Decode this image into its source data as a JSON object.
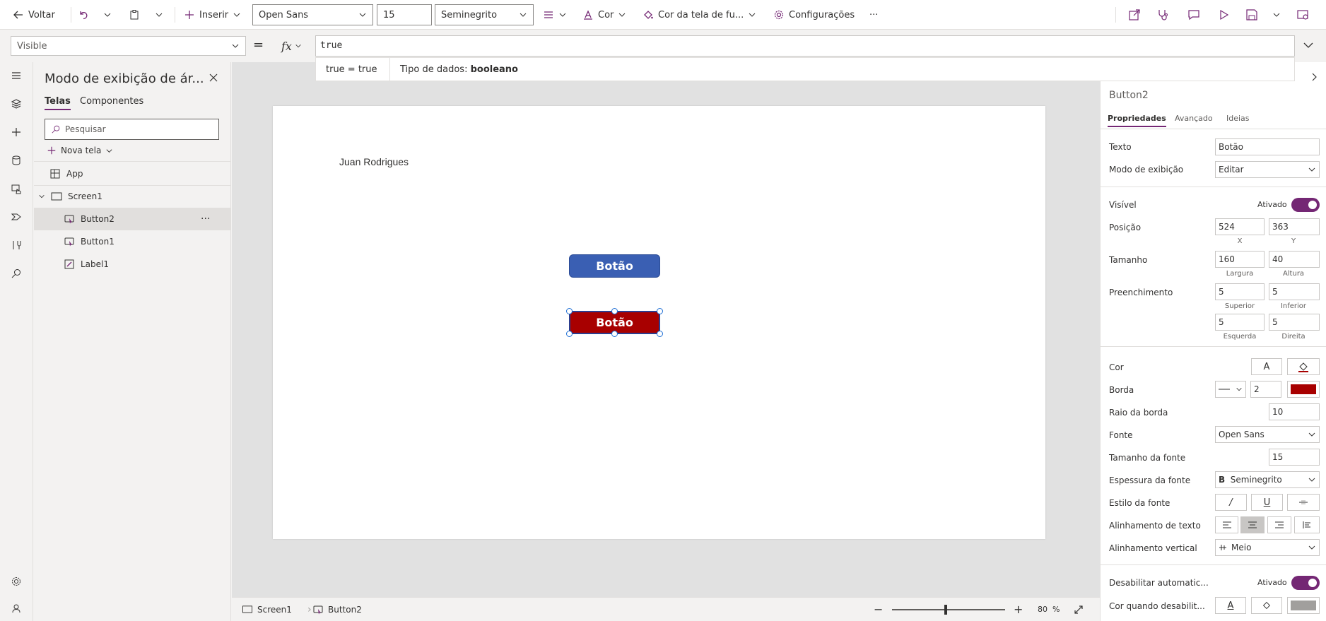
{
  "toolbar": {
    "back_label": "Voltar",
    "insert_label": "Inserir",
    "font_value": "Open Sans",
    "font_size_value": "15",
    "font_weight_value": "Seminegrito",
    "color_label": "Cor",
    "fill_label": "Cor da tela de fu...",
    "settings_label": "Configurações",
    "more_label": "···"
  },
  "formula_bar": {
    "property": "Visible",
    "equals": "=",
    "fx": "fx",
    "formula": "true",
    "hint_result": "true  =  true",
    "hint_type_prefix": "Tipo de dados: ",
    "hint_type": "booleano"
  },
  "tree": {
    "title": "Modo de exibição de ár...",
    "tab_screens": "Telas",
    "tab_components": "Componentes",
    "search_placeholder": "Pesquisar",
    "new_screen": "Nova tela",
    "items": [
      {
        "label": "App"
      },
      {
        "label": "Screen1"
      },
      {
        "label": "Button2"
      },
      {
        "label": "Button1"
      },
      {
        "label": "Label1"
      }
    ],
    "more": "···"
  },
  "canvas": {
    "label_text": "Juan Rodrigues",
    "button1_text": "Botão",
    "button2_text": "Botão"
  },
  "statusbar": {
    "screen": "Screen1",
    "control": "Button2",
    "zoom": "80",
    "zoom_unit": "%",
    "zoom_minus": "−",
    "zoom_plus": "+"
  },
  "props": {
    "control_name": "Button2",
    "tab_properties": "Propriedades",
    "tab_advanced": "Avançado",
    "tab_ideas": "Ideias",
    "text_label": "Texto",
    "text_value": "Botão",
    "display_mode_label": "Modo de exibição",
    "display_mode_value": "Editar",
    "visible_label": "Visível",
    "visible_state": "Ativado",
    "position_label": "Posição",
    "pos_x": "524",
    "pos_y": "363",
    "x_label": "X",
    "y_label": "Y",
    "size_label": "Tamanho",
    "width": "160",
    "height": "40",
    "width_label": "Largura",
    "height_label": "Altura",
    "padding_label": "Preenchimento",
    "pad_top": "5",
    "pad_bottom": "5",
    "pad_left": "5",
    "pad_right": "5",
    "top_label": "Superior",
    "bottom_label": "Inferior",
    "left_label": "Esquerda",
    "right_label": "Direita",
    "color_label": "Cor",
    "color_text_glyph": "A",
    "border_label": "Borda",
    "border_width": "2",
    "border_color": "#a80000",
    "radius_label": "Raio da borda",
    "radius_value": "10",
    "font_label": "Fonte",
    "font_value": "Open Sans",
    "font_size_label": "Tamanho da fonte",
    "font_size_value": "15",
    "font_weight_label": "Espessura da fonte",
    "font_weight_glyph": "B",
    "font_weight_value": "Seminegrito",
    "font_style_label": "Estilo da fonte",
    "italic_glyph": "/",
    "underline_glyph": "U",
    "text_align_label": "Alinhamento de texto",
    "vertical_align_label": "Alinhamento vertical",
    "vertical_align_value": "Meio",
    "auto_disable_label": "Desabilitar automatic...",
    "auto_disable_state": "Ativado",
    "disabled_color_label": "Cor quando desabilit...",
    "disabled_color_glyph": "A"
  }
}
